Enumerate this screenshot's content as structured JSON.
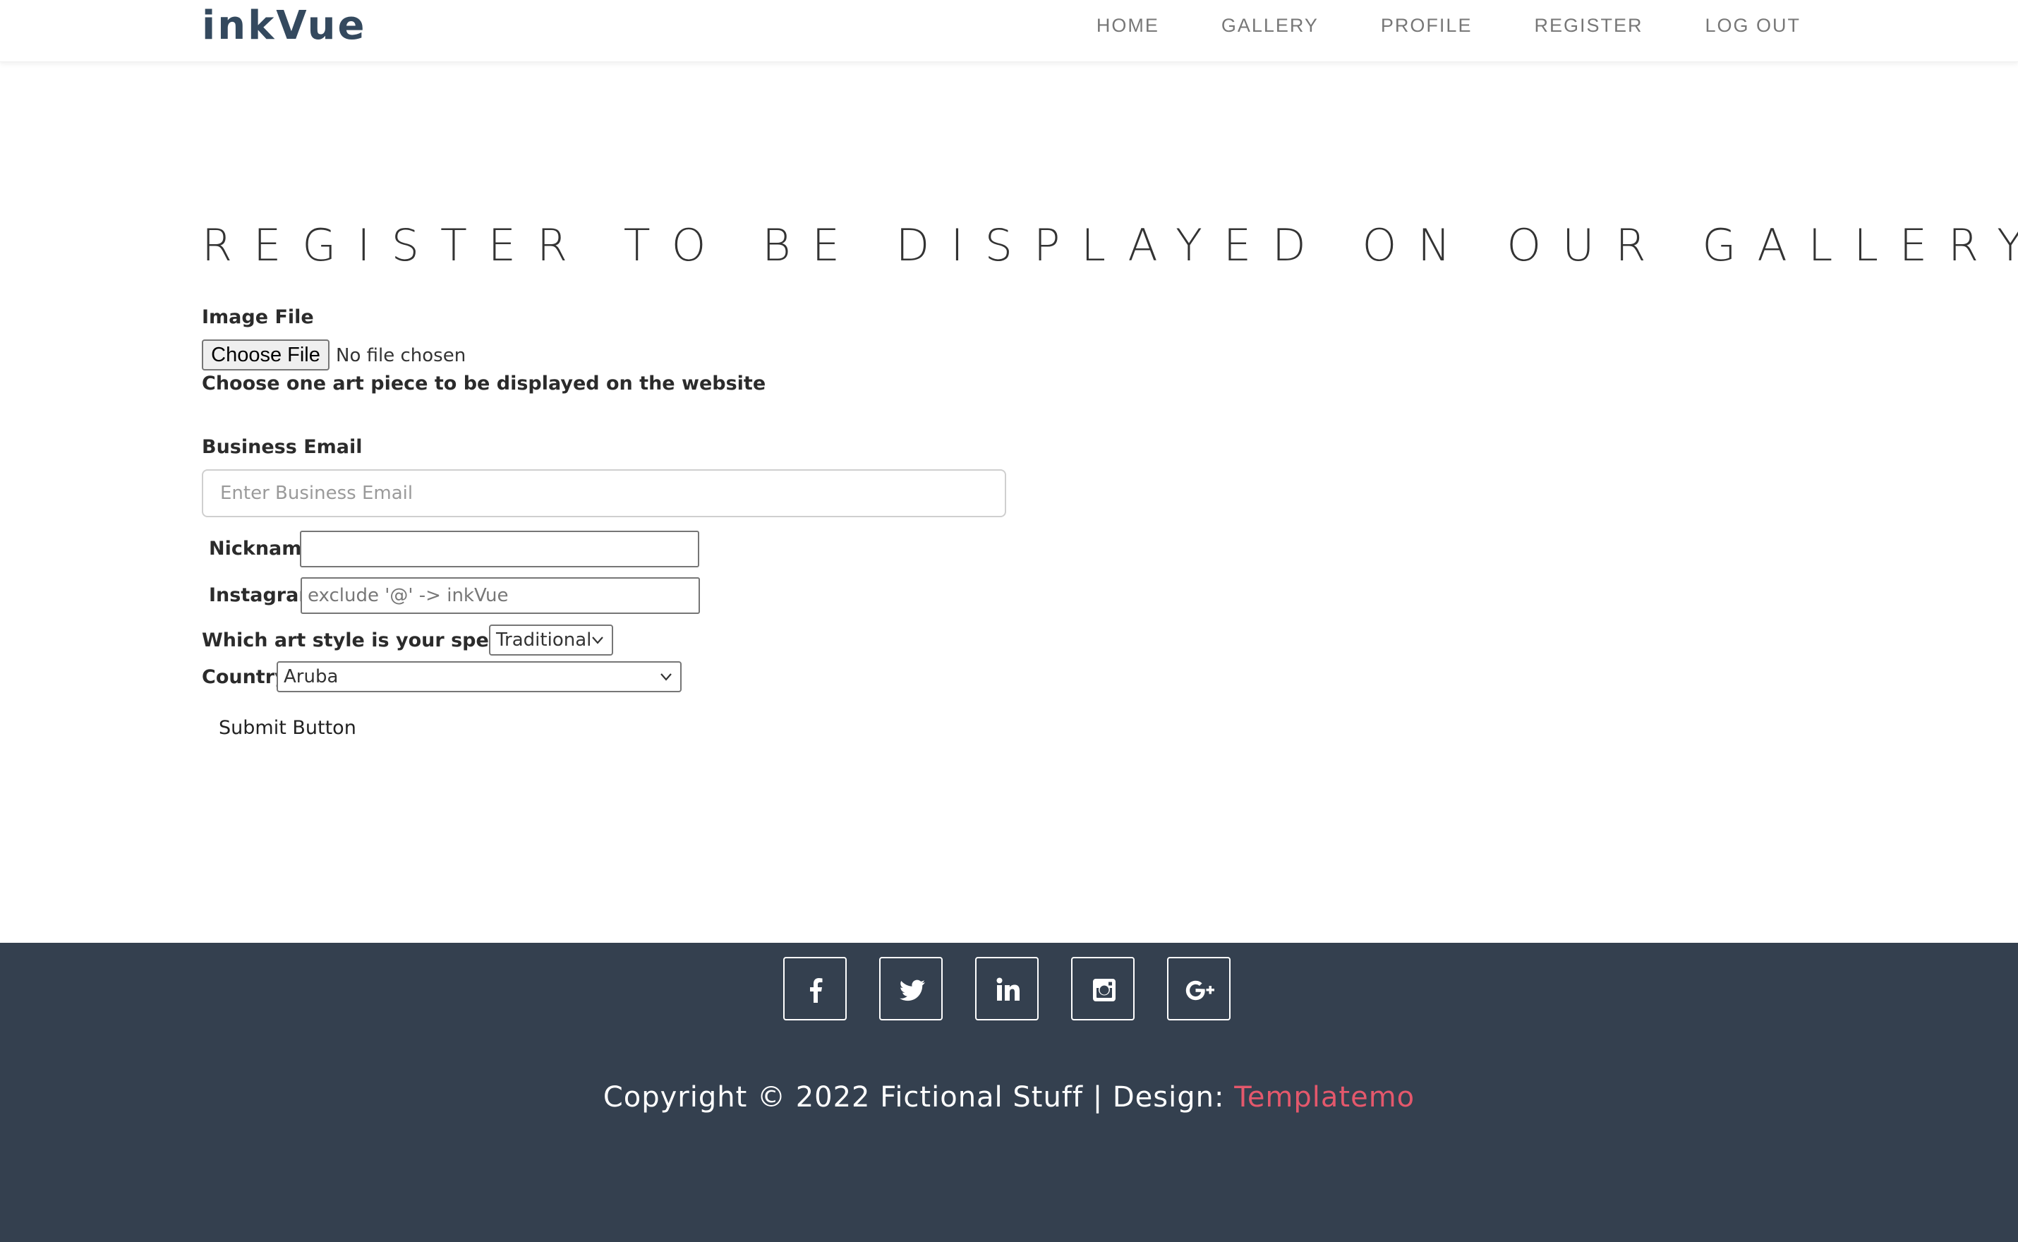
{
  "header": {
    "logo": "inkVue",
    "nav": [
      "HOME",
      "GALLERY",
      "PROFILE",
      "REGISTER",
      "LOG OUT"
    ]
  },
  "main": {
    "title": "REGISTER TO BE DISPLAYED ON OUR GALLERY",
    "image_file": {
      "label": "Image File",
      "button": "Choose File",
      "status": "No file chosen",
      "help": "Choose one art piece to be displayed on the website"
    },
    "business_email": {
      "label": "Business Email",
      "placeholder": "Enter Business Email",
      "value": ""
    },
    "nickname": {
      "label": "Nickname",
      "value": ""
    },
    "instagram": {
      "label": "Instagram",
      "placeholder": "exclude '@' -> inkVue"
    },
    "art_style": {
      "label": "Which art style is your specialty?",
      "selected": "Traditional"
    },
    "country": {
      "label": "Country",
      "selected": "Aruba"
    },
    "submit": "Submit Button"
  },
  "footer": {
    "social": [
      "facebook-icon",
      "twitter-icon",
      "linkedin-icon",
      "instagram-icon",
      "google-plus-icon"
    ],
    "copyright": "Copyright © 2022 Fictional Stuff | Design: ",
    "design_link": "Templatemo",
    "link_color": "#e4586c",
    "background": "#34404f"
  }
}
